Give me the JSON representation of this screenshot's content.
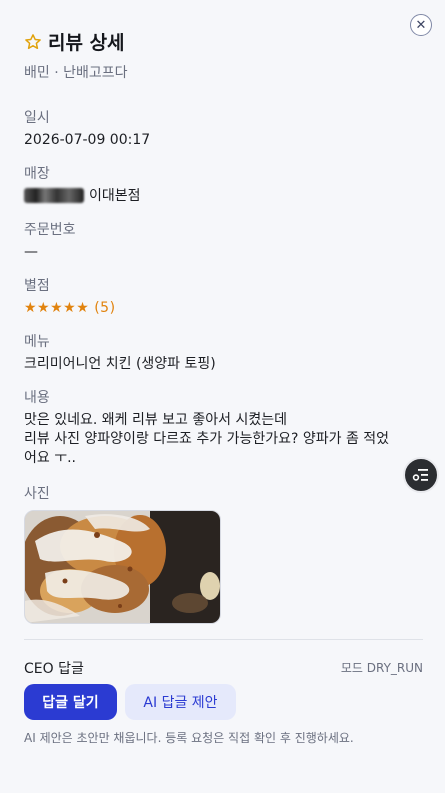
{
  "panel": {
    "title": "리뷰 상세",
    "subtitle": "배민 · 난배고프다",
    "close_label": "✕"
  },
  "fields": {
    "date_label": "일시",
    "date_value": "2026-07-09 00:17",
    "store_label": "매장",
    "store_value": "이대본점",
    "order_label": "주문번호",
    "order_value": "—",
    "rating_label": "별점",
    "rating_stars": "★★★★★",
    "rating_count": "(5)",
    "menu_label": "메뉴",
    "menu_value": "크리미어니언 치킨 (생양파 토핑)",
    "content_label": "내용",
    "content_line1": "맛은 있네요. 왜케 리뷰 보고 좋아서 시켰는데",
    "content_line2": "리뷰 사진 양파양이랑 다르죠 추가 가능한가요? 양파가 좀 적었",
    "content_line3": "어요 ㅜ..",
    "photo_label": "사진"
  },
  "reply": {
    "ceo_label": "CEO 답글",
    "mode_label": "모드 DRY_RUN",
    "reply_button": "답글 달기",
    "ai_button": "AI 답글 제안",
    "hint": "AI 제안은 초안만 채웁니다. 등록 요청은 직접 확인 후 진행하세요."
  },
  "icons": {
    "title_star": "star-outline-icon",
    "fab": "list-menu-icon"
  },
  "colors": {
    "accent": "#2b3bd2",
    "star": "#e1a30e",
    "rating": "#e1830e"
  }
}
